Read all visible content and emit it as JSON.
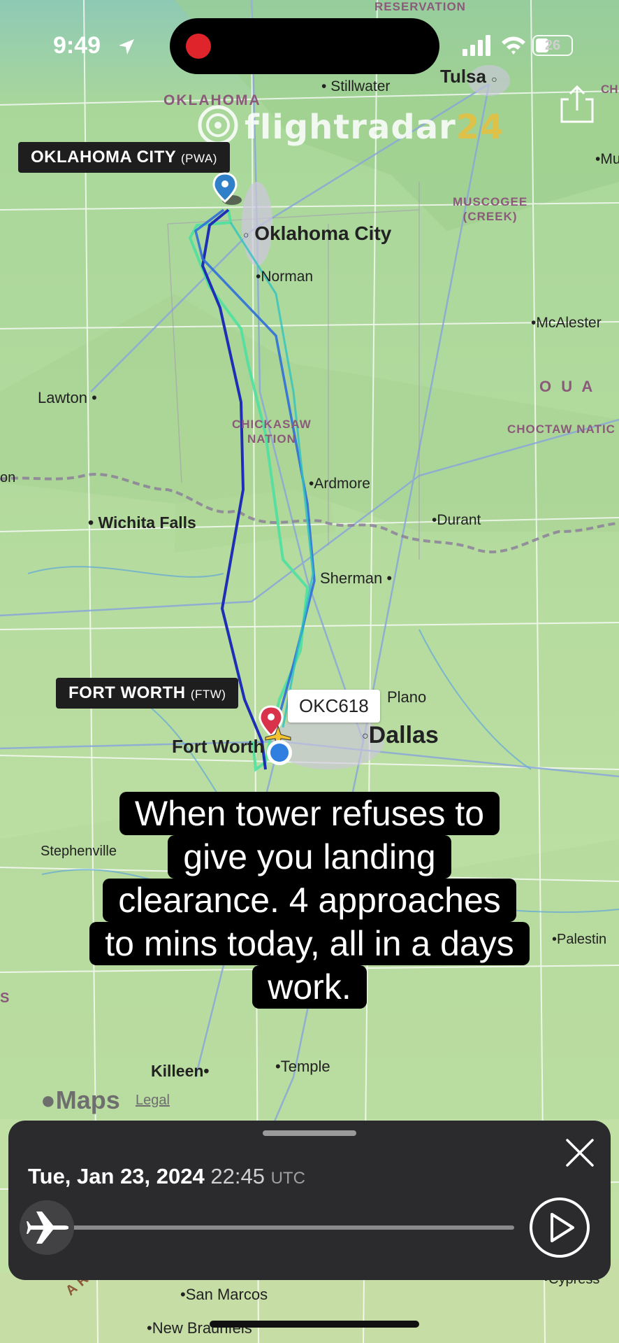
{
  "status_bar": {
    "time": "9:49",
    "battery": "26"
  },
  "watermark": {
    "brand": "flightradar",
    "brand_num": "24"
  },
  "map": {
    "labels": {
      "reservation": "RESERVATION",
      "oklahoma": "OKLAHOMA",
      "stillwater": "Stillwater",
      "tulsa": "Tulsa",
      "ch": "CH",
      "mu": "Mu",
      "muscogee_1": "MUSCOGEE",
      "muscogee_2": "(CREEK)",
      "oklahoma_city": "Oklahoma City",
      "norman": "Norman",
      "mcalester": "McAlester",
      "lawton": "Lawton",
      "oua": "O  U  A",
      "chickasaw_1": "CHICKASAW",
      "chickasaw_2": "NATION",
      "choctaw": "CHOCTAW NATIC",
      "on": "on",
      "ardmore": "Ardmore",
      "wichita_falls": "Wichita Falls",
      "durant": "Durant",
      "sherman": "Sherman",
      "plano": "Plano",
      "dallas": "Dallas",
      "fort_worth": "Fort Worth",
      "stephenville": "Stephenville",
      "palestine": "Palestin",
      "s": "S",
      "killeen": "Killeen",
      "temple": "Temple",
      "san_marcos": "San Marcos",
      "new_braunfels": "New Braunfels",
      "cypress": "Cypress",
      "arpme": "ARPME"
    },
    "origin": {
      "name": "OKLAHOMA CITY",
      "code": "(PWA)"
    },
    "destination": {
      "name": "FORT WORTH",
      "code": "(FTW)"
    },
    "flight": {
      "callsign": "OKC618"
    },
    "colors": {
      "track_dark": "#1f2fb5",
      "track_mid": "#2f6fd8",
      "track_light": "#4fe0a0",
      "origin_pin": "#2f80c8",
      "dest_pin": "#d8334a"
    }
  },
  "caption": {
    "lines": [
      "When tower refuses to",
      "give you landing",
      "clearance. 4 approaches",
      "to mins today, all in a days",
      "work."
    ]
  },
  "maps_brand": {
    "logo": "Maps",
    "legal": "Legal"
  },
  "playback": {
    "date": "Tue, Jan 23, 2024",
    "time": "22:45",
    "tz": "UTC",
    "progress": 0.0
  },
  "icons": {
    "location": "location-arrow-icon",
    "signal": "signal-icon",
    "wifi": "wifi-icon",
    "share": "share-icon",
    "close": "close-icon",
    "play": "play-icon",
    "plane": "airplane-icon"
  }
}
